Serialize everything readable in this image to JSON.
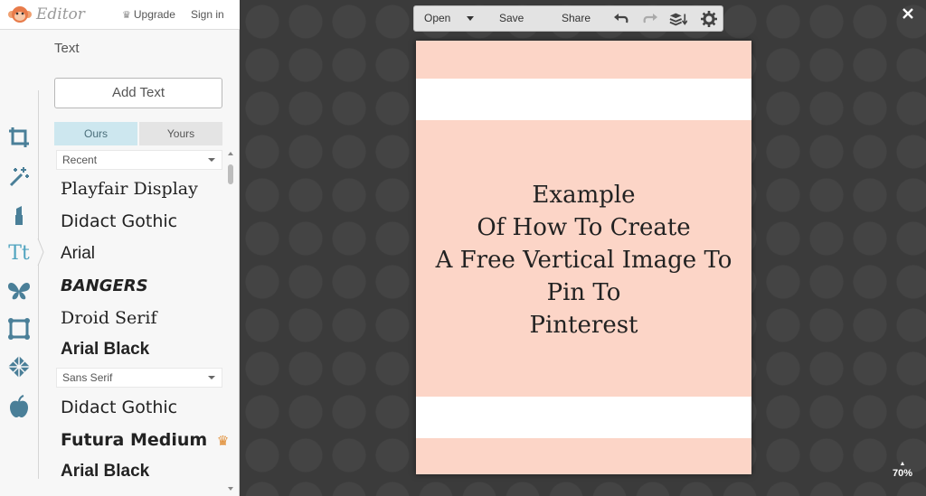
{
  "app": {
    "title": "Editor",
    "upgrade_label": "Upgrade",
    "signin_label": "Sign in"
  },
  "sidebar": {
    "panel_title": "Text",
    "add_text_label": "Add Text",
    "tabs": [
      {
        "label": "Ours",
        "active": true
      },
      {
        "label": "Yours",
        "active": false
      }
    ],
    "category_recent": "Recent",
    "category_sans": "Sans Serif",
    "fonts_recent": [
      "Playfair Display",
      "Didact Gothic",
      "Arial",
      "BANGERS",
      "Droid Serif",
      "Arial Black"
    ],
    "fonts_sans": [
      "Didact Gothic",
      "Futura Medium",
      "Arial Black"
    ],
    "rail_icons": [
      "crop-icon",
      "magic-wand-icon",
      "lipstick-icon",
      "text-icon",
      "butterfly-icon",
      "frame-icon",
      "texture-icon",
      "apple-icon"
    ],
    "active_rail_icon": "text-icon"
  },
  "toolbar": {
    "open_label": "Open",
    "save_label": "Save",
    "share_label": "Share"
  },
  "canvas": {
    "background_color": "#fcd5c7",
    "band_color": "#ffffff",
    "text_lines": [
      "Example",
      "Of How To Create",
      "A Free Vertical Image To",
      "Pin To",
      "Pinterest"
    ]
  },
  "zoom_label": "70%",
  "colors": {
    "accent": "#4fa3bf",
    "premium": "#e08a2e"
  }
}
